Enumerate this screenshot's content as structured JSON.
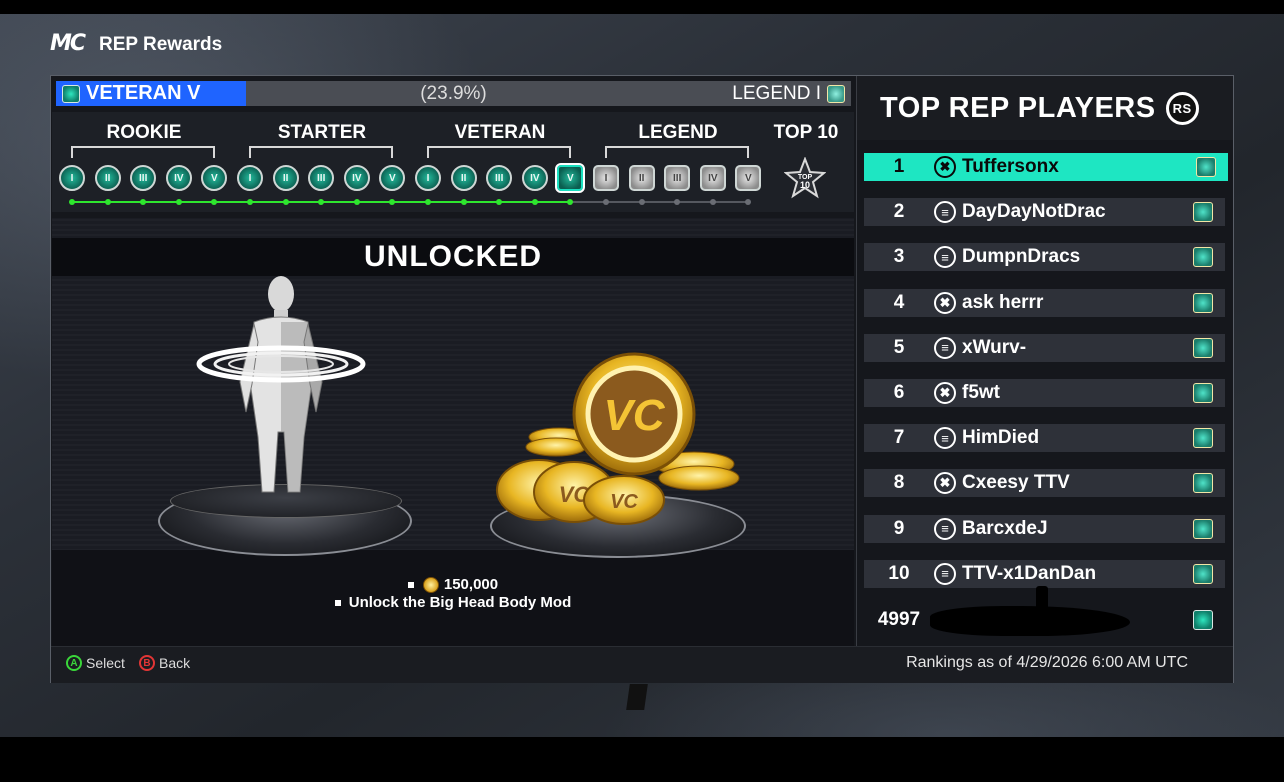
{
  "header": {
    "logo": "MC",
    "title": "REP Rewards"
  },
  "progress": {
    "current_level": "VETERAN V",
    "percent_text": "(23.9%)",
    "percent_value": 0.239,
    "next_level": "LEGEND I"
  },
  "tiers": {
    "groups": [
      {
        "name": "ROOKIE",
        "levels": [
          "I",
          "II",
          "III",
          "IV",
          "V"
        ],
        "style": "teal"
      },
      {
        "name": "STARTER",
        "levels": [
          "I",
          "II",
          "III",
          "IV",
          "V"
        ],
        "style": "teal"
      },
      {
        "name": "VETERAN",
        "levels": [
          "I",
          "II",
          "III",
          "IV",
          "V"
        ],
        "style": "teal"
      },
      {
        "name": "LEGEND",
        "levels": [
          "I",
          "II",
          "III",
          "IV",
          "V"
        ],
        "style": "silver"
      }
    ],
    "top10_label": "TOP 10",
    "top10_badge_text": "TOP 10",
    "completed_count": 15,
    "selected_index": 14
  },
  "reward": {
    "status": "UNLOCKED",
    "items": [
      {
        "icon": "vc-coin-icon",
        "text": "150,000"
      },
      {
        "icon": "bullet",
        "text": "Unlock the Big Head Body Mod"
      }
    ]
  },
  "leaderboard": {
    "title": "TOP REP PLAYERS",
    "title_icon": "RS",
    "rows": [
      {
        "rank": "1",
        "platform": "xbox",
        "name": "Tuffersonx",
        "highlight": true
      },
      {
        "rank": "2",
        "platform": "playstation",
        "name": "DayDayNotDrac"
      },
      {
        "rank": "3",
        "platform": "playstation",
        "name": "DumpnDracs"
      },
      {
        "rank": "4",
        "platform": "xbox",
        "name": "ask herrr"
      },
      {
        "rank": "5",
        "platform": "playstation",
        "name": "xWurv-"
      },
      {
        "rank": "6",
        "platform": "xbox",
        "name": "f5wt"
      },
      {
        "rank": "7",
        "platform": "playstation",
        "name": "HimDied"
      },
      {
        "rank": "8",
        "platform": "xbox",
        "name": "Cxeesy TTV"
      },
      {
        "rank": "9",
        "platform": "playstation",
        "name": "BarcxdeJ"
      },
      {
        "rank": "10",
        "platform": "playstation",
        "name": "TTV-x1DanDan"
      }
    ],
    "my_rank": "4997"
  },
  "footer": {
    "select_key": "A",
    "select_label": "Select",
    "back_key": "B",
    "back_label": "Back",
    "rankings_note": "Rankings as of 4/29/2026 6:00 AM UTC"
  },
  "colors": {
    "accent_teal": "#1ee6c2",
    "progress_blue": "#1f64ff",
    "progress_green": "#2ee62e",
    "a_button": "#3ad63a",
    "b_button": "#e23535"
  }
}
